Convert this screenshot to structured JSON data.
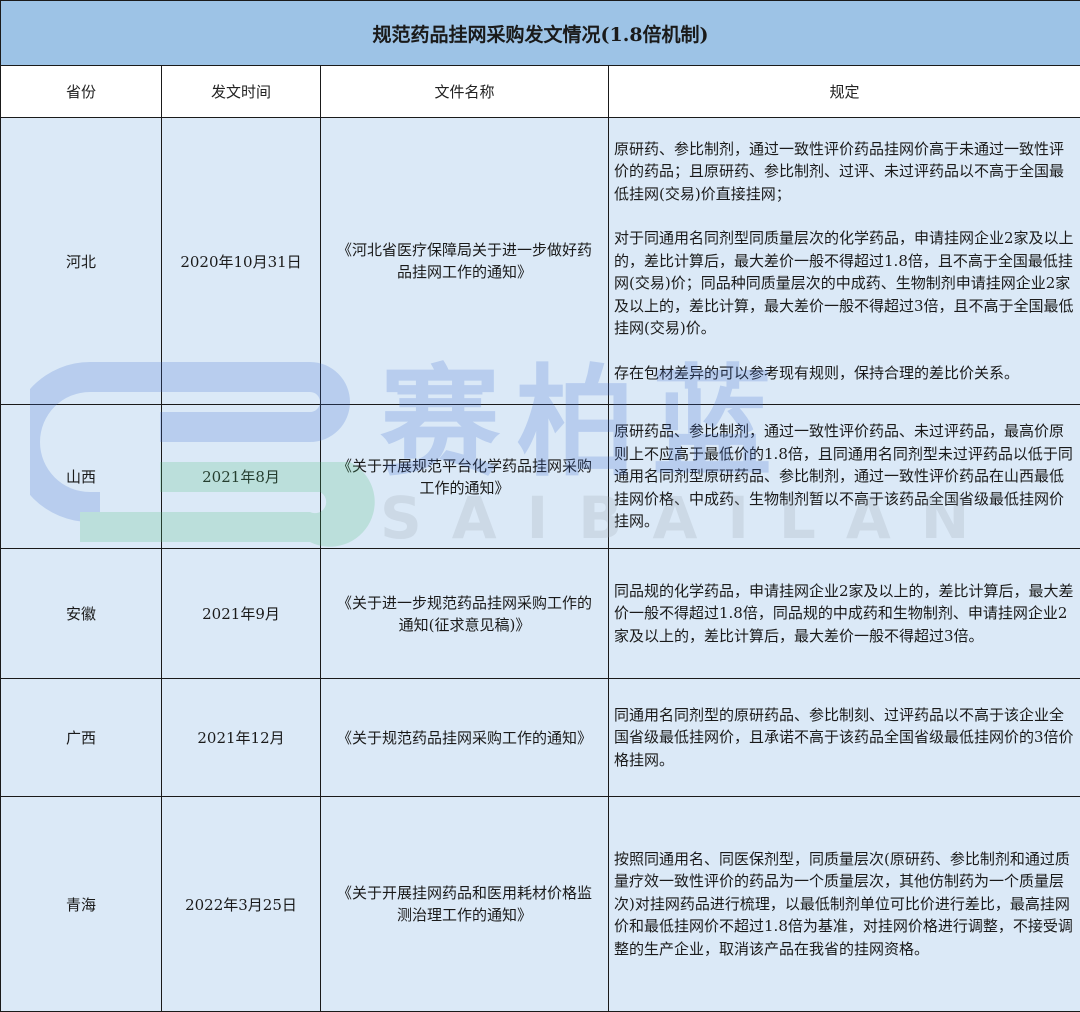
{
  "title": "规范药品挂网采购发文情况(1.8倍机制)",
  "columns": [
    "省份",
    "发文时间",
    "文件名称",
    "规定"
  ],
  "rows": [
    {
      "province": "河北",
      "date": "2020年10月31日",
      "doc": "《河北省医疗保障局关于进一步做好药品挂网工作的通知》",
      "rules": [
        "原研药、参比制剂，通过一致性评价药品挂网价高于未通过一致性评价的药品；且原研药、参比制剂、过评、未过评药品以不高于全国最低挂网(交易)价直接挂网；",
        "对于同通用名同剂型同质量层次的化学药品，申请挂网企业2家及以上的，差比计算后，最大差价一般不得超过1.8倍，且不高于全国最低挂网(交易)价；同品种同质量层次的中成药、生物制剂申请挂网企业2家及以上的，差比计算，最大差价一般不得超过3倍，且不高于全国最低挂网(交易)价。",
        "存在包材差异的可以参考现有规则，保持合理的差比价关系。"
      ]
    },
    {
      "province": "山西",
      "date": "2021年8月",
      "doc": "《关于开展规范平台化学药品挂网采购工作的通知》",
      "rules": [
        "原研药品、参比制剂，通过一致性评价药品、未过评药品，最高价原则上不应高于最低价的1.8倍，且同通用名同剂型未过评药品以低于同通用名同剂型原研药品、参比制剂，通过一致性评价药品在山西最低挂网价格、中成药、生物制剂暂以不高于该药品全国省级最低挂网价挂网。"
      ]
    },
    {
      "province": "安徽",
      "date": "2021年9月",
      "doc": "《关于进一步规范药品挂网采购工作的通知(征求意见稿)》",
      "rules": [
        "同品规的化学药品，申请挂网企业2家及以上的，差比计算后，最大差价一般不得超过1.8倍，同品规的中成药和生物制剂、申请挂网企业2家及以上的，差比计算后，最大差价一般不得超过3倍。"
      ]
    },
    {
      "province": "广西",
      "date": "2021年12月",
      "doc": "《关于规范药品挂网采购工作的通知》",
      "rules": [
        "同通用名同剂型的原研药品、参比制刻、过评药品以不高于该企业全国省级最低挂网价，且承诺不高于该药品全国省级最低挂网价的3倍价格挂网。"
      ]
    },
    {
      "province": "青海",
      "date": "2022年3月25日",
      "doc": "《关于开展挂网药品和医用耗材价格监测治理工作的通知》",
      "rules": [
        "按照同通用名、同医保剂型，同质量层次(原研药、参比制剂和通过质量疗效一致性评价的药品为一个质量层次，其他仿制药为一个质量层次)对挂网药品进行梳理，以最低制剂单位可比价进行差比，最高挂网价和最低挂网价不超过1.8倍为基准，对挂网价格进行调整，不接受调整的生产企业，取消该产品在我省的挂网资格。"
      ]
    }
  ],
  "watermark": {
    "brand": "赛柏蓝",
    "latin": "SAIBAILAN"
  }
}
